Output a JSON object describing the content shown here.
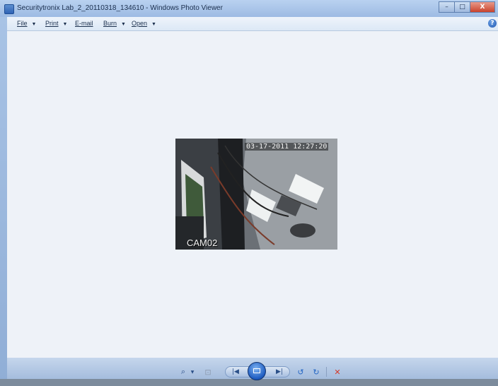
{
  "window": {
    "title": "Securitytronix Lab_2_20110318_134610 - Windows Photo Viewer"
  },
  "caption_buttons": {
    "minimize": "–",
    "maximize": "□",
    "close": "X"
  },
  "menu": {
    "file": "File",
    "print": "Print",
    "email": "E-mail",
    "burn": "Burn",
    "open": "Open",
    "help_icon": "question-icon"
  },
  "photo": {
    "osd_datetime": "03-17-2011 12:27:20",
    "osd_camera": "CAM02"
  },
  "controls": {
    "zoom_icon": "magnifier-icon",
    "fit_icon": "actual-size-icon",
    "previous_icon": "previous-icon",
    "slideshow_icon": "slideshow-icon",
    "next_icon": "next-icon",
    "rotate_left_icon": "rotate-counterclockwise-icon",
    "rotate_right_icon": "rotate-clockwise-icon",
    "delete_icon": "delete-icon"
  },
  "colors": {
    "viewer_background": "#eef2f8",
    "delete": "#d33a2a",
    "accent": "#1d5bc0"
  }
}
